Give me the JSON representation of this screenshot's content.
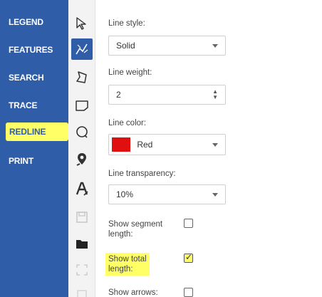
{
  "nav": {
    "items": [
      {
        "label": "LEGEND"
      },
      {
        "label": "FEATURES"
      },
      {
        "label": "SEARCH"
      },
      {
        "label": "TRACE"
      },
      {
        "label": "REDLINE",
        "active": true
      },
      {
        "label": "PRINT"
      }
    ]
  },
  "tools": [
    {
      "icon": "select-arrow-icon"
    },
    {
      "icon": "line-draw-icon",
      "active": true
    },
    {
      "icon": "polygon-icon"
    },
    {
      "icon": "rectangle-icon"
    },
    {
      "icon": "circle-icon"
    },
    {
      "icon": "marker-pin-icon"
    },
    {
      "icon": "text-icon"
    },
    {
      "icon": "save-icon"
    },
    {
      "icon": "folder-icon"
    },
    {
      "icon": "expand-icon"
    },
    {
      "icon": "extra-icon"
    }
  ],
  "panel": {
    "line_style": {
      "label": "Line style:",
      "value": "Solid"
    },
    "line_weight": {
      "label": "Line weight:",
      "value": "2"
    },
    "line_color": {
      "label": "Line color:",
      "value": "Red",
      "swatch": "#e01010"
    },
    "line_transparency": {
      "label": "Line transparency:",
      "value": "10%"
    },
    "show_segment_length": {
      "label_line1": "Show segment",
      "label_line2": "length:",
      "checked": false
    },
    "show_total_length": {
      "label_line1": "Show total",
      "label_line2": "length:",
      "checked": true
    },
    "show_arrows": {
      "label": "Show arrows:",
      "checked": false
    }
  },
  "colors": {
    "nav_bg": "#2f5da8",
    "highlight": "#ffff66",
    "accent": "#2f5da8"
  }
}
